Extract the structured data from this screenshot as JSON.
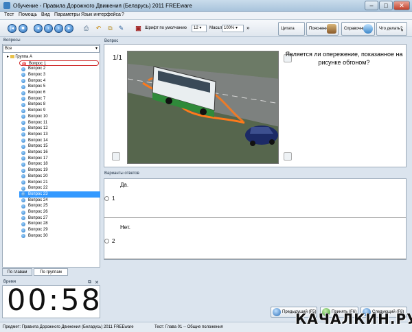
{
  "window": {
    "title": "Обучение - Правила Дорожного Движения (Беларусь) 2011 FREEware"
  },
  "menu": [
    "Тест",
    "Помощь",
    "Вид",
    "Параметры",
    "Язык интерфейса",
    "?"
  ],
  "toolbar": {
    "font_label": "Шрифт по умолчанию",
    "font_size": "12",
    "scale_label": "Масштаб:",
    "scale_value": "100%",
    "more": "»",
    "citation": "Цитата",
    "explanation": "Пояснение",
    "reference": "Справочник",
    "what_to_do": "Что делать?"
  },
  "left": {
    "header": "Вопросы",
    "filter": "Все",
    "group": "Группа А",
    "questions": [
      "Вопрос 1",
      "Вопрос 2",
      "Вопрос 3",
      "Вопрос 4",
      "Вопрос 5",
      "Вопрос 6",
      "Вопрос 7",
      "Вопрос 8",
      "Вопрос 9",
      "Вопрос 10",
      "Вопрос 11",
      "Вопрос 12",
      "Вопрос 13",
      "Вопрос 14",
      "Вопрос 15",
      "Вопрос 16",
      "Вопрос 17",
      "Вопрос 18",
      "Вопрос 19",
      "Вопрос 20",
      "Вопрос 21",
      "Вопрос 22",
      "Вопрос 23",
      "Вопрос 24",
      "Вопрос 25",
      "Вопрос 26",
      "Вопрос 27",
      "Вопрос 28",
      "Вопрос 29",
      "Вопрос 30"
    ],
    "tab_chapters": "По главам",
    "tab_groups": "По группам"
  },
  "timer": {
    "header": "Время",
    "value": "00:58"
  },
  "question": {
    "header": "Вопрос",
    "number": "1/1",
    "text": "Является ли опережение, показанное на рисунке обгоном?"
  },
  "answers": {
    "header": "Варианты ответов",
    "items": [
      {
        "text": "Да.",
        "num": "1"
      },
      {
        "text": "Нет.",
        "num": "2"
      }
    ]
  },
  "nav": {
    "prev": "Предыдущий (F5)",
    "accept": "Принять (F6)",
    "next": "Следующий (F8)"
  },
  "status": {
    "left": "Предмет: Правила Дорожного Движения (Беларусь) 2011 FREEware",
    "right": "Тест: Глава 01 -- Общие положения"
  },
  "watermark": "КАЧАЛКИН.РУ",
  "colors": {
    "selection": "#3399ff",
    "route_line": "#ff7a1a",
    "bus": "#e9eef0",
    "car": "#1c2a66"
  }
}
